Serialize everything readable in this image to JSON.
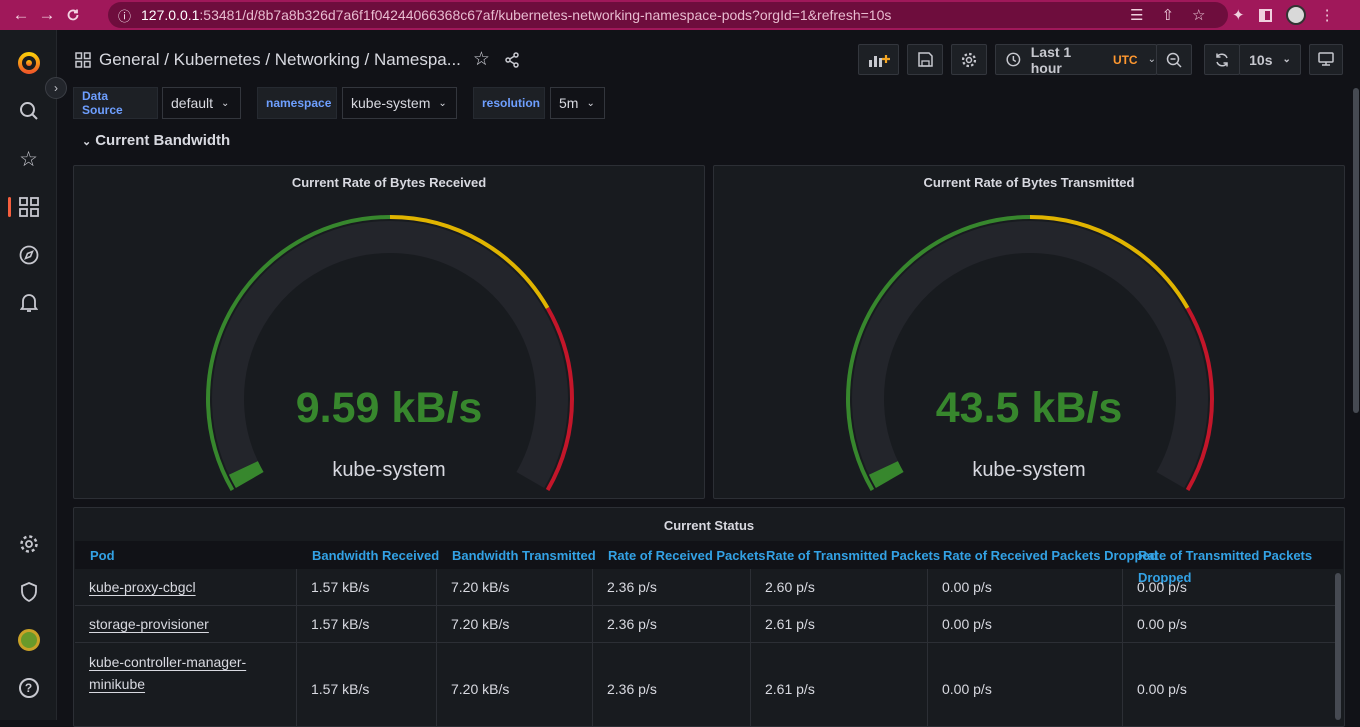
{
  "browser": {
    "url_host": "127.0.0.1",
    "url_rest": ":53481/d/8b7a8b326d7a6f1f04244066368c67af/kubernetes-networking-namespace-pods?orgId=1&refresh=10s"
  },
  "breadcrumb": {
    "folder": "General",
    "sep1": " / ",
    "title": "Kubernetes / Networking / Namespa..."
  },
  "toolbar": {
    "time_range": "Last 1 hour",
    "timezone": "UTC",
    "refresh_interval": "10s"
  },
  "variables": [
    {
      "label": "Data Source",
      "value": "default"
    },
    {
      "label": "namespace",
      "value": "kube-system"
    },
    {
      "label": "resolution",
      "value": "5m"
    }
  ],
  "row": {
    "title": "Current Bandwidth"
  },
  "gauges": [
    {
      "title": "Current Rate of Bytes Received",
      "value": "9.59 kB/s",
      "series": "kube-system",
      "fraction": 0.02
    },
    {
      "title": "Current Rate of Bytes Transmitted",
      "value": "43.5 kB/s",
      "series": "kube-system",
      "fraction": 0.02
    }
  ],
  "colors": {
    "green": "#37872d",
    "yellow": "#e0b400",
    "red": "#c4162a",
    "accent": "#33a2e5"
  },
  "table": {
    "title": "Current Status",
    "columns": [
      "Pod",
      "Bandwidth Received",
      "Bandwidth Transmitted",
      "Rate of Received Packets",
      "Rate of Transmitted Packets",
      "Rate of Received Packets Dropped",
      "Rate of Transmitted Packets Dropped"
    ],
    "rows": [
      [
        "kube-proxy-cbgcl",
        "1.57 kB/s",
        "7.20 kB/s",
        "2.36 p/s",
        "2.60 p/s",
        "0.00 p/s",
        "0.00 p/s"
      ],
      [
        "storage-provisioner",
        "1.57 kB/s",
        "7.20 kB/s",
        "2.36 p/s",
        "2.61 p/s",
        "0.00 p/s",
        "0.00 p/s"
      ],
      [
        "kube-controller-manager-minikube",
        "1.57 kB/s",
        "7.20 kB/s",
        "2.36 p/s",
        "2.61 p/s",
        "0.00 p/s",
        "0.00 p/s"
      ]
    ]
  }
}
